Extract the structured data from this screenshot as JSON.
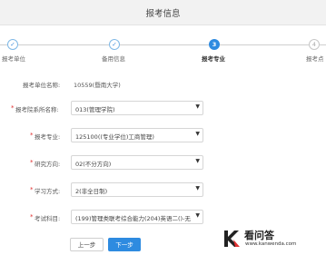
{
  "header": {
    "title": "报考信息"
  },
  "steps": [
    {
      "label": "报考单位",
      "marker": "✓",
      "state": "done"
    },
    {
      "label": "备用信息",
      "marker": "✓",
      "state": "done"
    },
    {
      "label": "报考专业",
      "marker": "3",
      "state": "active"
    },
    {
      "label": "报考点",
      "marker": "4",
      "state": "todo"
    }
  ],
  "form": {
    "unit": {
      "label": "报考单位名称:",
      "value": "10559(暨南大学)"
    },
    "department": {
      "label": "报考院系所名称:",
      "value": "013(管理学院)"
    },
    "major": {
      "label": "报考专业:",
      "value": "125100((专业学位)工商管理)"
    },
    "direction": {
      "label": "研究方向:",
      "value": "02(不分方向)"
    },
    "study_mode": {
      "label": "学习方式:",
      "value": "2(非全日制)"
    },
    "subjects": {
      "label": "考试科目:",
      "value": "(199)管理类联考综合能力(204)英语二()-无"
    },
    "required_mark": "*",
    "dropdown_arrow": "▼"
  },
  "buttons": {
    "prev": "上一步",
    "next": "下一步"
  },
  "watermark": {
    "name": "看问答",
    "url": "www.kanwenda.com"
  },
  "colors": {
    "accent": "#2e8be0",
    "required": "#e03030"
  }
}
